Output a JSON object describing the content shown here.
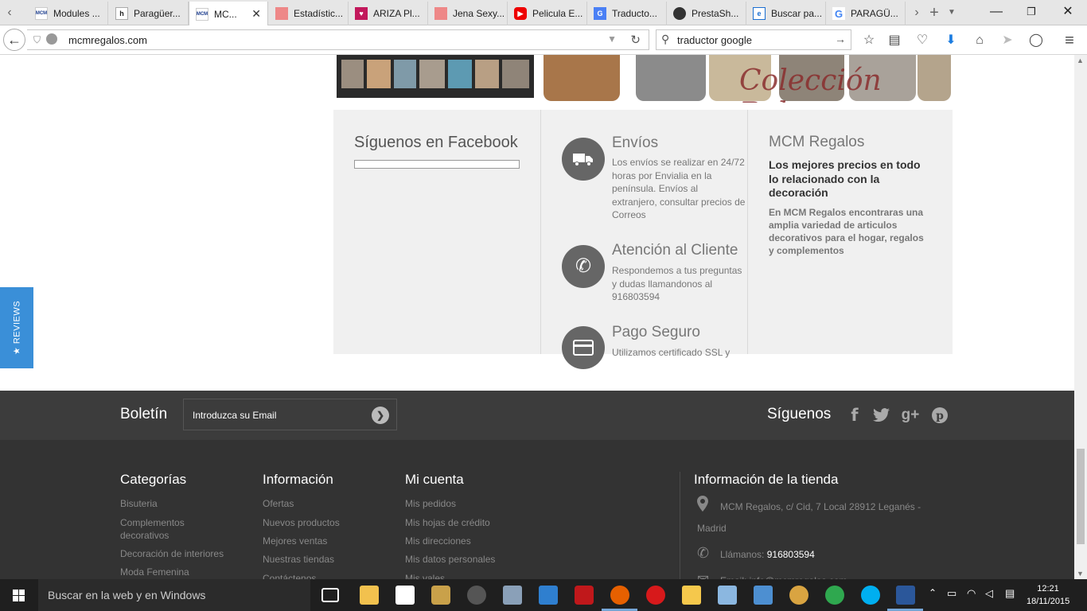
{
  "browser": {
    "tabs": [
      {
        "title": "Modules ...",
        "favicon": "mcm-favicon"
      },
      {
        "title": "Paragüer...",
        "favicon": "h-favicon"
      },
      {
        "title": "MC...",
        "favicon": "mcm-favicon",
        "active": true
      },
      {
        "title": "Estadístic...",
        "favicon": "image-favicon"
      },
      {
        "title": "ARIZA Pl...",
        "favicon": "heart-favicon"
      },
      {
        "title": "Jena Sexy...",
        "favicon": "image-favicon"
      },
      {
        "title": "Pelicula E...",
        "favicon": "youtube-favicon"
      },
      {
        "title": "Traducto...",
        "favicon": "translate-favicon"
      },
      {
        "title": "PrestaSh...",
        "favicon": "prestashop-favicon"
      },
      {
        "title": "Buscar pa...",
        "favicon": "ie-favicon"
      },
      {
        "title": "PARAGÜ...",
        "favicon": "google-favicon"
      }
    ],
    "tab_close": "✕",
    "new_tab": "+",
    "url": "mcmregalos.com",
    "search_query": "traductor google"
  },
  "banner": {
    "collection_text": "Colección Bolsos"
  },
  "facebook": {
    "title": "Síguenos en Facebook"
  },
  "services": [
    {
      "title": "Envíos",
      "icon": "truck-icon",
      "text": "Los envíos se realizar en 24/72 horas por Envialia en la península. Envíos al extranjero, consultar precios de Correos"
    },
    {
      "title": "Atención al Cliente",
      "icon": "phone-icon",
      "text": "Respondemos a tus preguntas y dudas llamandonos al 916803594"
    },
    {
      "title": "Pago Seguro",
      "icon": "credit-card-icon",
      "text": "Utilizamos certificado SSL y"
    }
  ],
  "about": {
    "title": "MCM Regalos",
    "headline": "Los mejores precios en todo lo relacionado con la decoración",
    "body": "En MCM Regalos encontraras una amplia variedad de articulos decorativos para el hogar, regalos y complementos"
  },
  "reviews_tab": {
    "label": "★ REVIEWS"
  },
  "newsletter": {
    "label": "Boletín",
    "placeholder": "Introduzca su Email",
    "follow_label": "Síguenos",
    "social": [
      "facebook-icon",
      "twitter-icon",
      "google-plus-icon",
      "pinterest-icon"
    ]
  },
  "footer": {
    "categories": {
      "title": "Categorías",
      "links": [
        "Bisuteria",
        "Complementos decorativos",
        "Decoración de interiores",
        "Moda Femenina"
      ]
    },
    "information": {
      "title": "Información",
      "links": [
        "Ofertas",
        "Nuevos productos",
        "Mejores ventas",
        "Nuestras tiendas",
        "Contáctenos"
      ]
    },
    "account": {
      "title": "Mi cuenta",
      "links": [
        "Mis pedidos",
        "Mis hojas de crédito",
        "Mis direcciones",
        "Mis datos personales",
        "Mis vales"
      ]
    },
    "store": {
      "title": "Información de la tienda",
      "address": "MCM Regalos, c/ Cid, 7 Local 28912 Leganés - Madrid",
      "phone_label": "Llámanos:",
      "phone": "916803594",
      "email_label": "Email: info@mcmregalos.com"
    }
  },
  "taskbar": {
    "search_placeholder": "Buscar en la web y en Windows",
    "time": "12:21",
    "date": "18/11/2015"
  },
  "colors": {
    "reviews_blue": "#3a8fd8",
    "footer_dark": "#333333",
    "newsletter_dark": "#3c3c3c",
    "panel_gray": "#f0f0f0"
  }
}
